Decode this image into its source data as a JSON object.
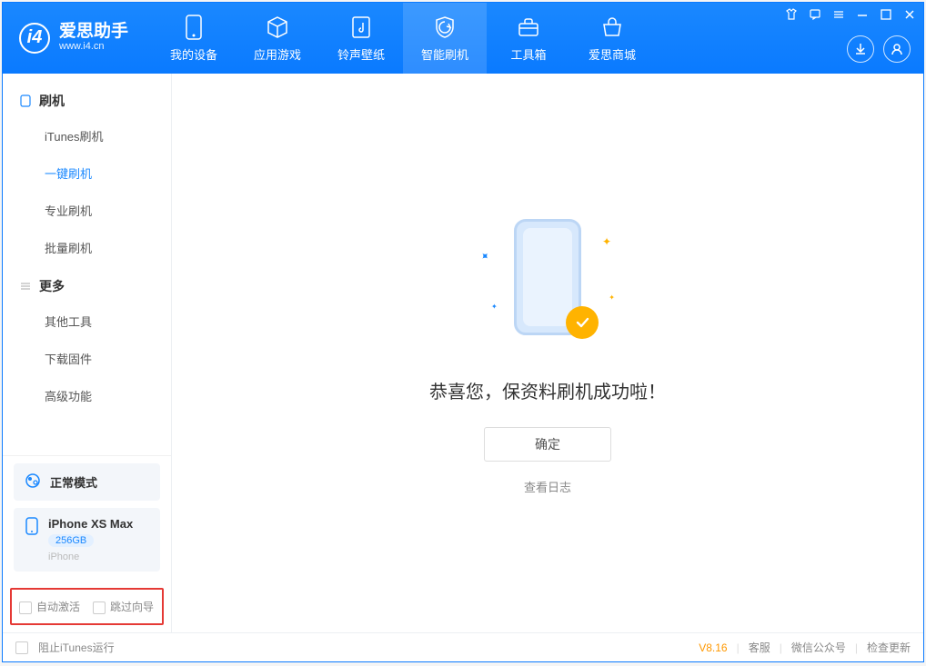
{
  "app": {
    "name_cn": "爱思助手",
    "name_en": "www.i4.cn"
  },
  "nav": [
    {
      "label": "我的设备",
      "icon": "device"
    },
    {
      "label": "应用游戏",
      "icon": "cube"
    },
    {
      "label": "铃声壁纸",
      "icon": "music"
    },
    {
      "label": "智能刷机",
      "icon": "shield",
      "active": true
    },
    {
      "label": "工具箱",
      "icon": "toolbox"
    },
    {
      "label": "爱思商城",
      "icon": "store"
    }
  ],
  "sidebar": {
    "groups": [
      {
        "title": "刷机",
        "icon": "phone",
        "items": [
          {
            "label": "iTunes刷机"
          },
          {
            "label": "一键刷机",
            "active": true
          },
          {
            "label": "专业刷机"
          },
          {
            "label": "批量刷机"
          }
        ]
      },
      {
        "title": "更多",
        "icon": "menu",
        "items": [
          {
            "label": "其他工具"
          },
          {
            "label": "下载固件"
          },
          {
            "label": "高级功能"
          }
        ]
      }
    ],
    "mode_label": "正常模式",
    "device": {
      "name": "iPhone XS Max",
      "capacity": "256GB",
      "type": "iPhone"
    },
    "options": {
      "auto_activate": "自动激活",
      "skip_guide": "跳过向导"
    }
  },
  "main": {
    "success_text": "恭喜您，保资料刷机成功啦！",
    "ok_button": "确定",
    "view_log": "查看日志"
  },
  "footer": {
    "block_itunes": "阻止iTunes运行",
    "version": "V8.16",
    "links": [
      "客服",
      "微信公众号",
      "检查更新"
    ]
  }
}
